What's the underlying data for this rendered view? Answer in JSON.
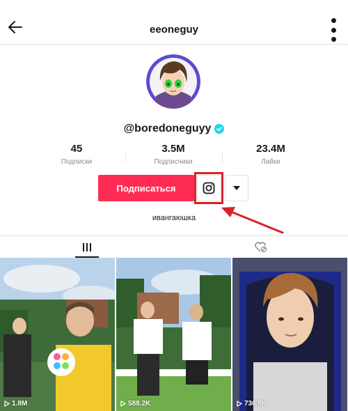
{
  "header": {
    "title": "eeoneguy",
    "back_icon": "arrow-left-icon",
    "more_icon": "more-vertical-icon"
  },
  "profile": {
    "username": "@boredoneguyy",
    "verified": true,
    "bio": "ивангаюшка"
  },
  "stats": [
    {
      "value": "45",
      "label": "Подписки"
    },
    {
      "value": "3.5M",
      "label": "Подписчики"
    },
    {
      "value": "23.4M",
      "label": "Лайки"
    }
  ],
  "actions": {
    "follow_label": "Подписаться",
    "instagram_icon": "instagram-icon",
    "dropdown_icon": "caret-down-icon"
  },
  "tabs": [
    {
      "icon": "videos-grid-icon",
      "active": true
    },
    {
      "icon": "liked-heart-icon",
      "active": false
    }
  ],
  "videos": [
    {
      "views": "1.8M"
    },
    {
      "views": "588.2K"
    },
    {
      "views": "736.8K"
    }
  ],
  "colors": {
    "accent": "#fe2c55",
    "verified": "#20d5ec",
    "annotation": "#d8232a"
  }
}
